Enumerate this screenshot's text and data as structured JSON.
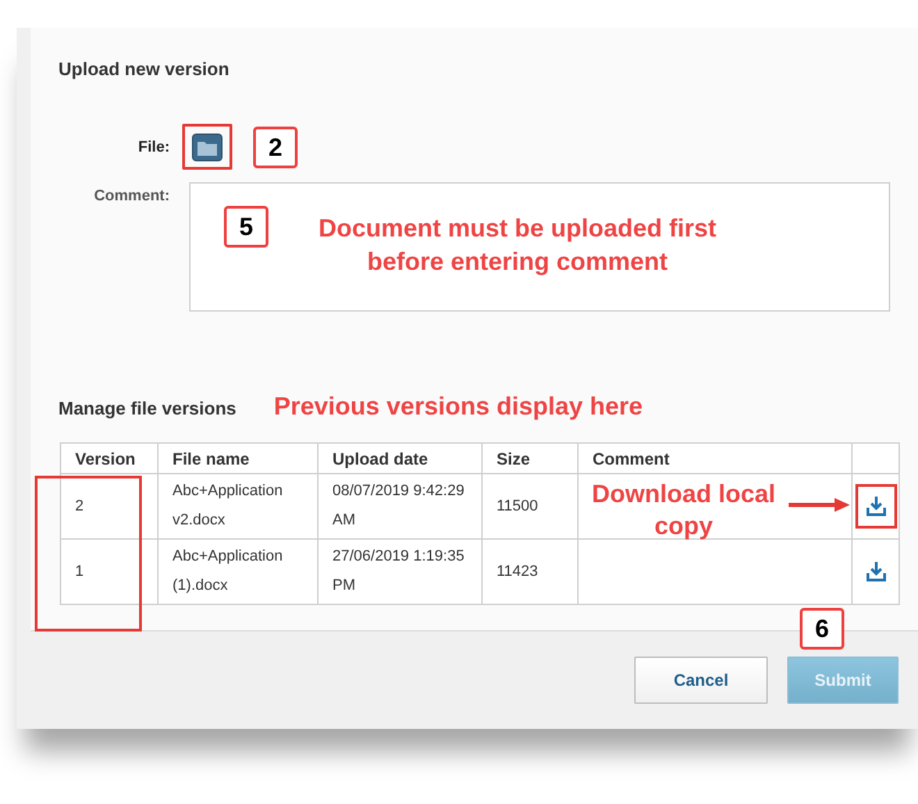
{
  "dialog": {
    "title": "Upload new version"
  },
  "file": {
    "label": "File:",
    "callout": "2"
  },
  "comment": {
    "label": "Comment:",
    "callout": "5",
    "note": "Document must be uploaded first before entering comment"
  },
  "versions": {
    "title": "Manage file versions",
    "note": "Previous versions display here",
    "columns": [
      "Version",
      "File name",
      "Upload date",
      "Size",
      "Comment"
    ],
    "rows": [
      {
        "version": "2",
        "file_name": "Abc+Application v2.docx",
        "upload_date": "08/07/2019 9:42:29 AM",
        "size": "11500",
        "highlighted": true
      },
      {
        "version": "1",
        "file_name": "Abc+Application (1).docx",
        "upload_date": "27/06/2019 1:19:35 PM",
        "size": "11423",
        "highlighted": false
      }
    ],
    "download_note": "Download local copy"
  },
  "buttons": [
    {
      "label": "Cancel",
      "kind": "secondary",
      "disabled": false
    },
    {
      "label": "Submit",
      "kind": "primary",
      "disabled": true,
      "callout": "6"
    }
  ]
}
